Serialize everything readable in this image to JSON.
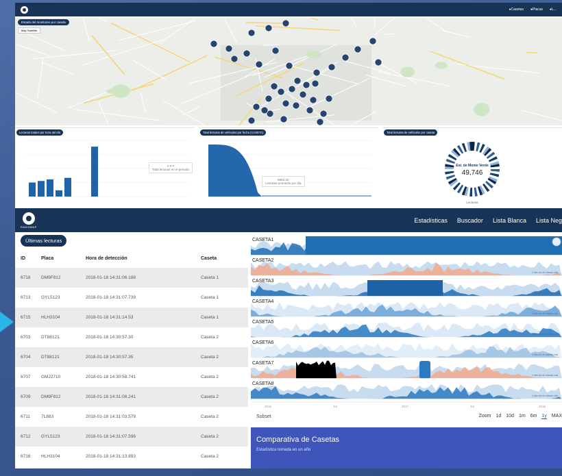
{
  "colors": {
    "navy": "#173356",
    "accent_blue": "#1f6fb5",
    "light_blue": "#b9d3ec",
    "mid_blue": "#6ba3d6",
    "salmon": "#f2a98c",
    "comparativa_bg": "#3f55ba"
  },
  "back": {
    "nav": [
      "Casetas",
      "Placas",
      "L..."
    ],
    "map": {
      "label": "Estado del monitoreo por caseta",
      "toggle": "Map  Satellite"
    },
    "card1": {
      "title": "Lecturas totales por hora del día",
      "tip_title": "# # #",
      "tip_sub": "Total lecturas en el período"
    },
    "card2": {
      "title": "Total lecturas de vehículos por fecha (CASETA)",
      "tip_title": "8664.32",
      "tip_sub": "Lecturas promedio por día"
    },
    "card3": {
      "title": "Total lecturas de vehículos por caseta",
      "donut_title": "Est. de Monte Verde",
      "donut_value": "49,746",
      "caption": "Lecturas"
    }
  },
  "front": {
    "brand": "RADIOMAP",
    "nav": [
      "Estadísticas",
      "Buscador",
      "Lista Blanca",
      "Lista Negra"
    ],
    "table": {
      "pill": "Últimas lecturas",
      "headers": [
        "ID",
        "Placa",
        "Hora de detección",
        "Caseta"
      ],
      "rows": [
        [
          "6718",
          "DM9F812",
          "2018-01-18 14:31:06.188",
          "Caseta 1"
        ],
        [
          "6713",
          "GYL5123",
          "2018-01-18 14:31:07.739",
          "Caseta 1"
        ],
        [
          "6715",
          "HLH3104",
          "2018-01-18 14:31:14.53",
          "Caseta 1"
        ],
        [
          "6703",
          "DT88121",
          "2018-01-18 14:30:57.30",
          "Caseta 2"
        ],
        [
          "6704",
          "DT88121",
          "2018-01-18 14:30:57.35",
          "Caseta 2"
        ],
        [
          "6707",
          "GMJ2710",
          "2018-01-18 14:30:58.741",
          "Caseta 2"
        ],
        [
          "6709",
          "DM9F812",
          "2018-01-18 14:31:06.241",
          "Caseta 2"
        ],
        [
          "6711",
          "7L883",
          "2018-01-18 14:31:03.579",
          "Caseta 2"
        ],
        [
          "6712",
          "GYL5123",
          "2018-01-18 14:31:07.596",
          "Caseta 2"
        ],
        [
          "6716",
          "HLH3104",
          "2018-01-18 14:31:13.893",
          "Caseta 2"
        ]
      ]
    },
    "casetas": {
      "labels": [
        "CASETA1",
        "CASETA2",
        "CASETA3",
        "CASETA4",
        "CASETA5",
        "CASETA6",
        "CASETA7",
        "CASETA8"
      ],
      "row_note": "1 dia en el mismo día",
      "axis_ticks": [
        "2016",
        "Jul",
        "2017",
        "Jul",
        "2018"
      ]
    },
    "zoom": {
      "left": "Subset",
      "label": "Zoom",
      "options": [
        "1d",
        "10d",
        "1m",
        "6m",
        "1y",
        "MAX"
      ],
      "active": "1y"
    },
    "comparativa": {
      "title": "Comparativa de Casetas",
      "subtitle": "Estadística tomada en un año"
    }
  }
}
